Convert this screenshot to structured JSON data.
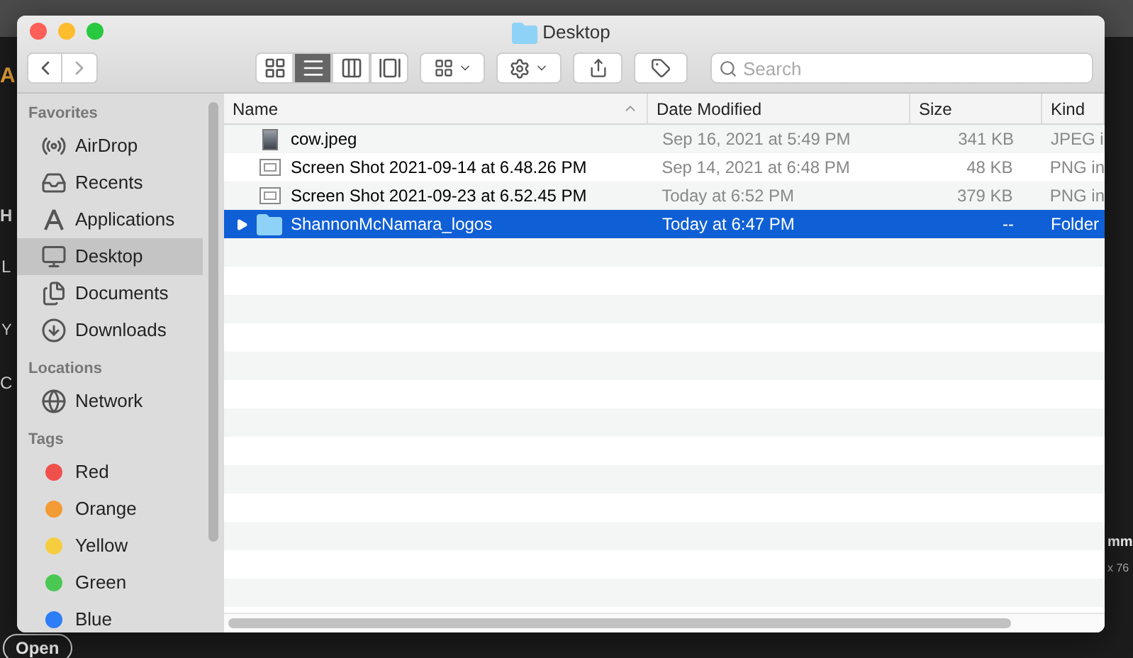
{
  "background_app": {
    "texts": [
      "A",
      "H",
      "L",
      "Y",
      "C",
      "mm",
      "x 76"
    ],
    "open_button": "Open"
  },
  "window": {
    "title": "Desktop"
  },
  "toolbar": {
    "view_modes": [
      {
        "kind": "icons",
        "selected": false
      },
      {
        "kind": "list",
        "selected": true
      },
      {
        "kind": "columns",
        "selected": false
      },
      {
        "kind": "gallery",
        "selected": false
      }
    ],
    "search": {
      "placeholder": "Search"
    }
  },
  "sidebar": {
    "sections": [
      {
        "title": "Favorites",
        "items": [
          {
            "label": "AirDrop",
            "kind": "airdrop",
            "selected": false
          },
          {
            "label": "Recents",
            "kind": "recents",
            "selected": false
          },
          {
            "label": "Applications",
            "kind": "applications",
            "selected": false
          },
          {
            "label": "Desktop",
            "kind": "desktop",
            "selected": true
          },
          {
            "label": "Documents",
            "kind": "documents",
            "selected": false
          },
          {
            "label": "Downloads",
            "kind": "downloads",
            "selected": false
          }
        ]
      },
      {
        "title": "Locations",
        "items": [
          {
            "label": "Network",
            "kind": "network",
            "selected": false
          }
        ]
      },
      {
        "title": "Tags",
        "items": [
          {
            "label": "Red",
            "kind": "tag",
            "color": "#f0504c",
            "selected": false
          },
          {
            "label": "Orange",
            "kind": "tag",
            "color": "#f39b34",
            "selected": false
          },
          {
            "label": "Yellow",
            "kind": "tag",
            "color": "#f6cd3f",
            "selected": false
          },
          {
            "label": "Green",
            "kind": "tag",
            "color": "#4ac853",
            "selected": false
          },
          {
            "label": "Blue",
            "kind": "tag",
            "color": "#2d7df6",
            "selected": false
          }
        ]
      }
    ]
  },
  "table": {
    "columns": [
      {
        "label": "Name",
        "sorted": true
      },
      {
        "label": "Date Modified",
        "sorted": false
      },
      {
        "label": "Size",
        "sorted": false
      },
      {
        "label": "Kind",
        "sorted": false
      }
    ],
    "rows": [
      {
        "kind": "image",
        "name": "cow.jpeg",
        "date": "Sep 16, 2021 at 5:49 PM",
        "size": "341 KB",
        "type": "JPEG i",
        "selected": false
      },
      {
        "kind": "screenshot",
        "name": "Screen Shot 2021-09-14 at 6.48.26 PM",
        "date": "Sep 14, 2021 at 6:48 PM",
        "size": "48 KB",
        "type": "PNG in",
        "selected": false
      },
      {
        "kind": "screenshot",
        "name": "Screen Shot 2021-09-23 at 6.52.45 PM",
        "date": "Today at 6:52 PM",
        "size": "379 KB",
        "type": "PNG in",
        "selected": false
      },
      {
        "kind": "folder",
        "name": "ShannonMcNamara_logos",
        "date": "Today at 6:47 PM",
        "size": "--",
        "type": "Folder",
        "selected": true
      }
    ]
  }
}
